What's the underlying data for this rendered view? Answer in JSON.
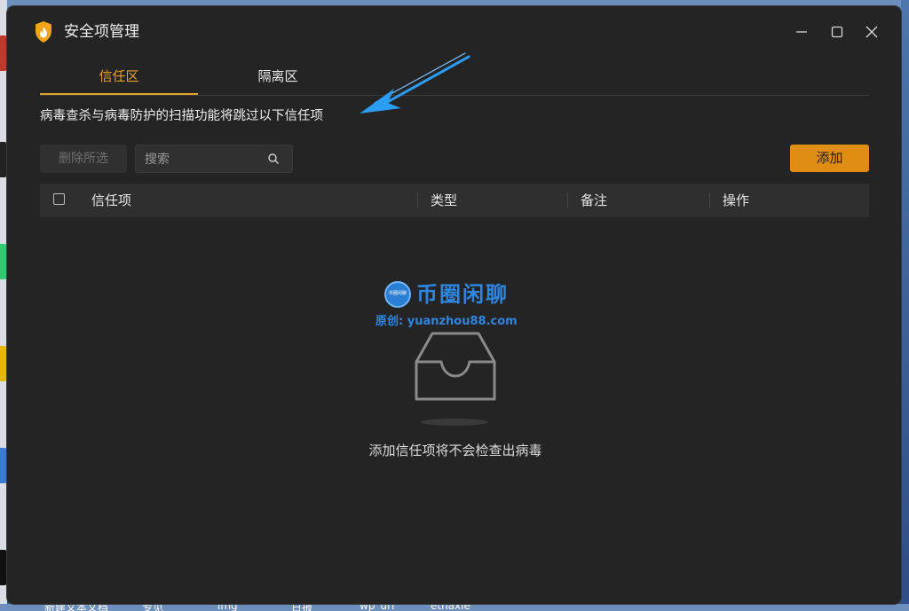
{
  "window": {
    "title": "安全项管理",
    "controls": {
      "minimize": "minimize-icon",
      "maximize": "maximize-icon",
      "close": "close-icon"
    }
  },
  "tabs": [
    {
      "label": "信任区",
      "active": true
    },
    {
      "label": "隔离区",
      "active": false
    }
  ],
  "description": "病毒查杀与病毒防护的扫描功能将跳过以下信任项",
  "toolbar": {
    "delete_label": "删除所选",
    "search_placeholder": "搜索",
    "add_label": "添加"
  },
  "table": {
    "columns": [
      "信任项",
      "类型",
      "备注",
      "操作"
    ],
    "rows": []
  },
  "empty_state": {
    "message": "添加信任项将不会检查出病毒",
    "icon": "empty-inbox-icon"
  },
  "watermark": {
    "badge": "币圈闲聊",
    "title": "币圈闲聊",
    "subtitle": "原创: yuanzhou88.com"
  },
  "desktop": {
    "taskbar_labels": [
      "新建文本文档",
      "专见",
      "img",
      "日报",
      "wp_url",
      "ethaxie"
    ]
  },
  "colors": {
    "accent": "#e6a128",
    "add_button": "#e08d14",
    "window_bg": "#242424",
    "annotation_arrow": "#2a9df4"
  }
}
